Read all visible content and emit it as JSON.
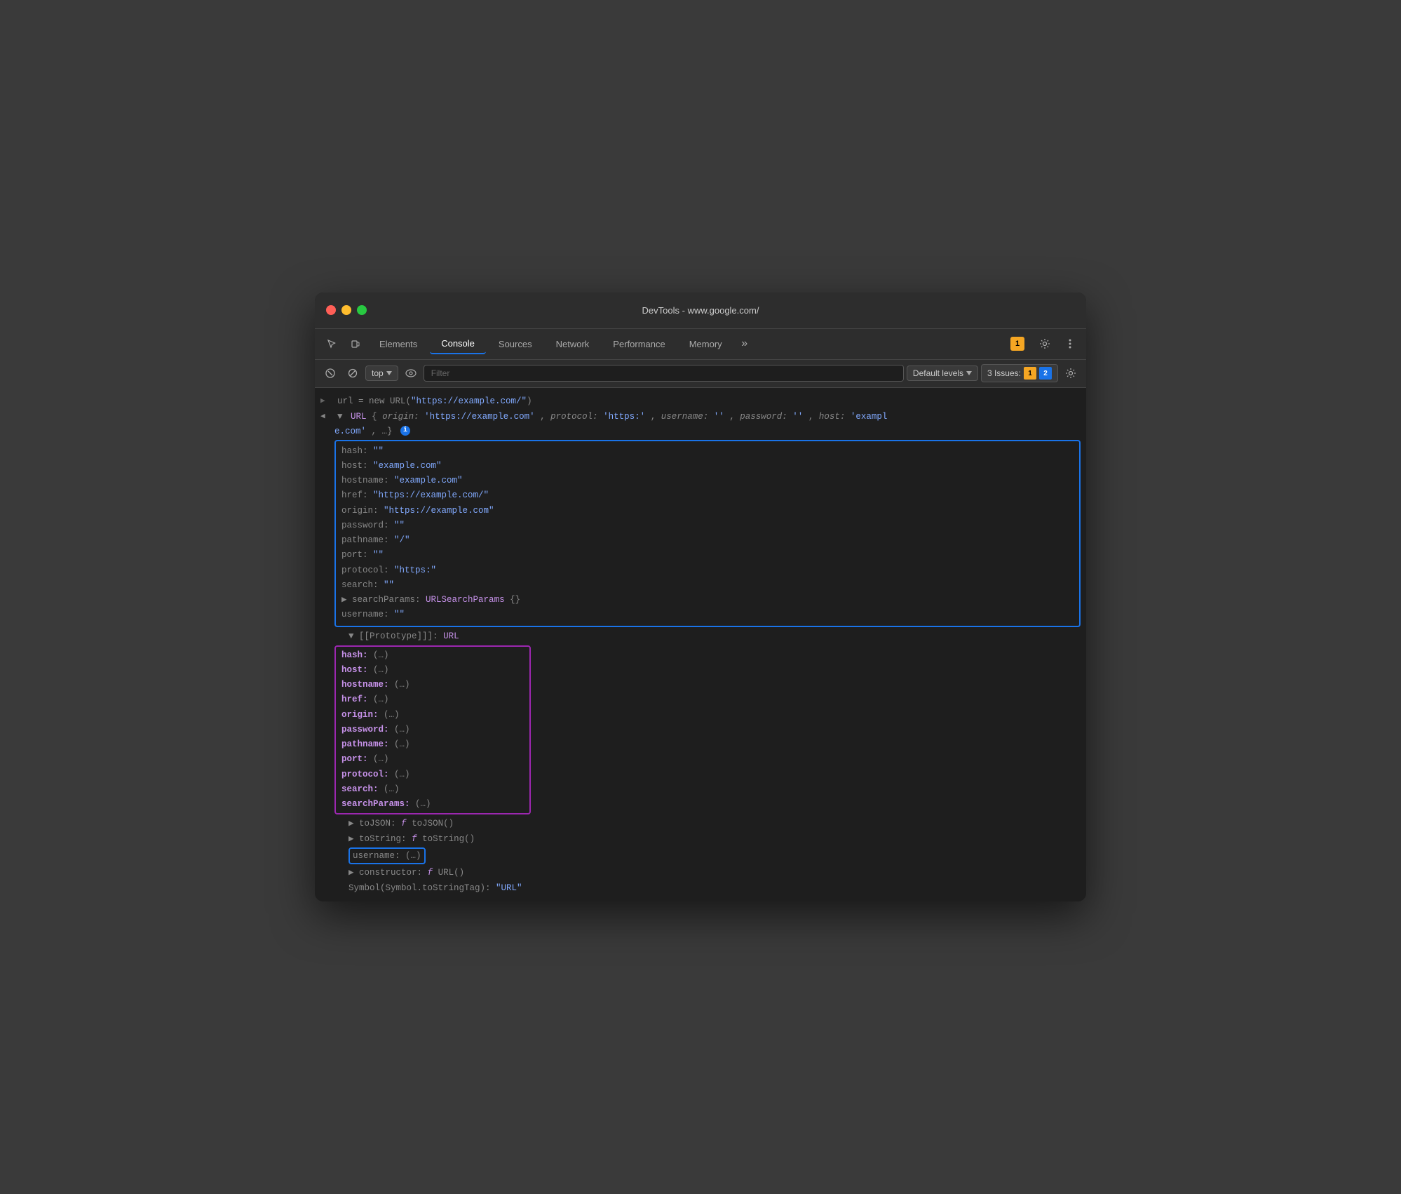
{
  "window": {
    "title": "DevTools - www.google.com/"
  },
  "tabs": {
    "items": [
      {
        "label": "Elements",
        "active": false
      },
      {
        "label": "Console",
        "active": true
      },
      {
        "label": "Sources",
        "active": false
      },
      {
        "label": "Network",
        "active": false
      },
      {
        "label": "Performance",
        "active": false
      },
      {
        "label": "Memory",
        "active": false
      }
    ],
    "more_label": "»"
  },
  "toolbar": {
    "context": "top",
    "filter_placeholder": "Filter",
    "levels_label": "Default levels",
    "issues_label": "3 Issues:",
    "issues_warn_count": "1",
    "issues_info_count": "2"
  },
  "console": {
    "line1": "url = new URL(\"https://example.com/\")",
    "line2_prefix": "▼ URL {",
    "line2_props": "origin: 'https://example.com', protocol: 'https:', username: '', password: '', host: 'exampl",
    "line2_cont": "e.com', …}",
    "url_props": [
      {
        "name": "hash:",
        "value": "\"\""
      },
      {
        "name": "host:",
        "value": "\"example.com\""
      },
      {
        "name": "hostname:",
        "value": "\"example.com\""
      },
      {
        "name": "href:",
        "value": "\"https://example.com/\""
      },
      {
        "name": "origin:",
        "value": "\"https://example.com\""
      },
      {
        "name": "password:",
        "value": "\"\""
      },
      {
        "name": "pathname:",
        "value": "\"/\""
      },
      {
        "name": "port:",
        "value": "\"\""
      },
      {
        "name": "protocol:",
        "value": "\"https:\""
      },
      {
        "name": "search:",
        "value": "\"\""
      }
    ],
    "searchParams_label": "▶ searchParams:",
    "searchParams_val": "URLSearchParams {}",
    "username_label": "username:",
    "username_val": "\"\"",
    "prototype_label": "▼ [[Prototype]]: URL",
    "proto_props": [
      {
        "name": "hash:",
        "value": "(...)"
      },
      {
        "name": "host:",
        "value": "(...)"
      },
      {
        "name": "hostname:",
        "value": "(...)"
      },
      {
        "name": "href:",
        "value": "(...)"
      },
      {
        "name": "origin:",
        "value": "(...)"
      },
      {
        "name": "password:",
        "value": "(...)"
      },
      {
        "name": "pathname:",
        "value": "(...)"
      },
      {
        "name": "port:",
        "value": "(...)"
      },
      {
        "name": "protocol:",
        "value": "(...)"
      },
      {
        "name": "search:",
        "value": "(...)"
      },
      {
        "name": "searchParams:",
        "value": "(...)"
      }
    ],
    "toJSON_label": "▶ toJSON:",
    "toJSON_val": "f toJSON()",
    "toString_label": "▶ toString:",
    "toString_val": "f toString()",
    "username_proto_label": "username:",
    "username_proto_val": "(...)",
    "constructor_label": "▶ constructor:",
    "constructor_val": "f URL()",
    "symbol_label": "Symbol(Symbol.toStringTag):",
    "symbol_val": "\"URL\""
  }
}
